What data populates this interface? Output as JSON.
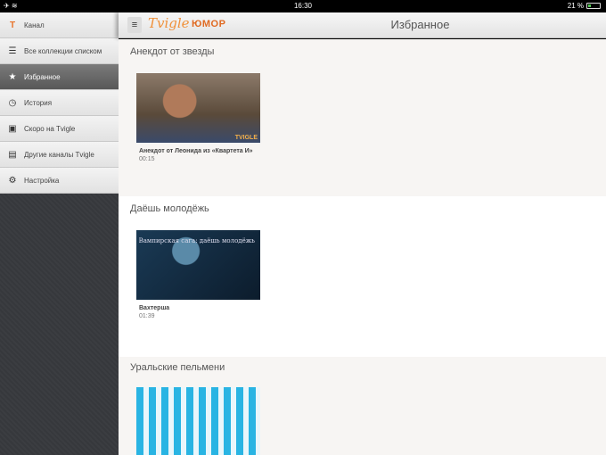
{
  "status": {
    "time": "16:30",
    "battery": "21 %"
  },
  "sidebar": {
    "items": [
      {
        "label": "Канал",
        "icon": "tvigle-logo-icon"
      },
      {
        "label": "Все коллекции списком",
        "icon": "list-icon"
      },
      {
        "label": "Избранное",
        "icon": "star-icon"
      },
      {
        "label": "История",
        "icon": "clock-icon"
      },
      {
        "label": "Скоро на Tvigle",
        "icon": "calendar-icon"
      },
      {
        "label": "Другие каналы Tvigle",
        "icon": "briefcase-icon"
      },
      {
        "label": "Настройка",
        "icon": "gear-icon"
      }
    ],
    "active": 2
  },
  "header": {
    "logo": "Tvigle",
    "channel": "ЮМОР",
    "title": "Избранное"
  },
  "sections": [
    {
      "title": "Анекдот от звезды",
      "videos": [
        {
          "title": "Анекдот от Леонида из «Квартета И»",
          "duration": "00:15"
        }
      ]
    },
    {
      "title": "Даёшь молодёжь",
      "videos": [
        {
          "title": "Вахтерша",
          "duration": "01:39",
          "overlay": "Вампирская сага: даёшь молодёжь"
        }
      ]
    },
    {
      "title": "Уральские пельмени",
      "videos": []
    }
  ]
}
